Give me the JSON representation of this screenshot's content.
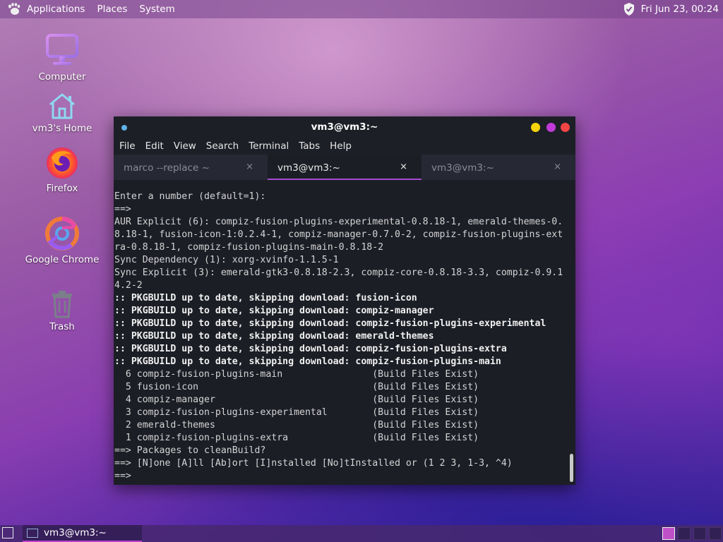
{
  "top_panel": {
    "menu": [
      "Applications",
      "Places",
      "System"
    ],
    "clock": "Fri Jun 23, 00:24"
  },
  "desktop": {
    "icons": [
      {
        "label": "Computer",
        "icon": "computer-icon"
      },
      {
        "label": "vm3's Home",
        "icon": "home-icon"
      },
      {
        "label": "Firefox",
        "icon": "firefox-icon"
      },
      {
        "label": "Google Chrome",
        "icon": "chrome-icon"
      },
      {
        "label": "Trash",
        "icon": "trash-icon"
      }
    ]
  },
  "window": {
    "title": "vm3@vm3:~",
    "menu": [
      "File",
      "Edit",
      "View",
      "Search",
      "Terminal",
      "Tabs",
      "Help"
    ],
    "tabs": [
      {
        "label": "marco --replace ~",
        "active": false
      },
      {
        "label": "vm3@vm3:~",
        "active": true
      },
      {
        "label": "vm3@vm3:~",
        "active": false
      }
    ],
    "close_glyph": "×",
    "button_colors": {
      "minimize": "#f5d30a",
      "maximize": "#c13ad9",
      "close": "#f24545"
    }
  },
  "terminal": {
    "lines": [
      {
        "text": "Enter a number (default=1):",
        "bold": false
      },
      {
        "text": "==>",
        "bold": false
      },
      {
        "text": "AUR Explicit (6): compiz-fusion-plugins-experimental-0.8.18-1, emerald-themes-0.",
        "bold": false
      },
      {
        "text": "8.18-1, fusion-icon-1:0.2.4-1, compiz-manager-0.7.0-2, compiz-fusion-plugins-ext",
        "bold": false
      },
      {
        "text": "ra-0.8.18-1, compiz-fusion-plugins-main-0.8.18-2",
        "bold": false
      },
      {
        "text": "Sync Dependency (1): xorg-xvinfo-1.1.5-1",
        "bold": false
      },
      {
        "text": "Sync Explicit (3): emerald-gtk3-0.8.18-2.3, compiz-core-0.8.18-3.3, compiz-0.9.1",
        "bold": false
      },
      {
        "text": "4.2-2",
        "bold": false
      },
      {
        "text": ":: PKGBUILD up to date, skipping download: fusion-icon",
        "bold": true
      },
      {
        "text": ":: PKGBUILD up to date, skipping download: compiz-manager",
        "bold": true
      },
      {
        "text": ":: PKGBUILD up to date, skipping download: compiz-fusion-plugins-experimental",
        "bold": true
      },
      {
        "text": ":: PKGBUILD up to date, skipping download: emerald-themes",
        "bold": true
      },
      {
        "text": ":: PKGBUILD up to date, skipping download: compiz-fusion-plugins-extra",
        "bold": true
      },
      {
        "text": ":: PKGBUILD up to date, skipping download: compiz-fusion-plugins-main",
        "bold": true
      },
      {
        "text": "  6 compiz-fusion-plugins-main                (Build Files Exist)",
        "bold": false
      },
      {
        "text": "  5 fusion-icon                               (Build Files Exist)",
        "bold": false
      },
      {
        "text": "  4 compiz-manager                            (Build Files Exist)",
        "bold": false
      },
      {
        "text": "  3 compiz-fusion-plugins-experimental        (Build Files Exist)",
        "bold": false
      },
      {
        "text": "  2 emerald-themes                            (Build Files Exist)",
        "bold": false
      },
      {
        "text": "  1 compiz-fusion-plugins-extra               (Build Files Exist)",
        "bold": false
      },
      {
        "text": "==> Packages to cleanBuild?",
        "bold": false
      },
      {
        "text": "==> [N]one [A]ll [Ab]ort [I]nstalled [No]tInstalled or (1 2 3, 1-3, ^4)",
        "bold": false
      },
      {
        "text": "==>",
        "bold": false
      }
    ]
  },
  "bottom_panel": {
    "task": "vm3@vm3:~"
  }
}
